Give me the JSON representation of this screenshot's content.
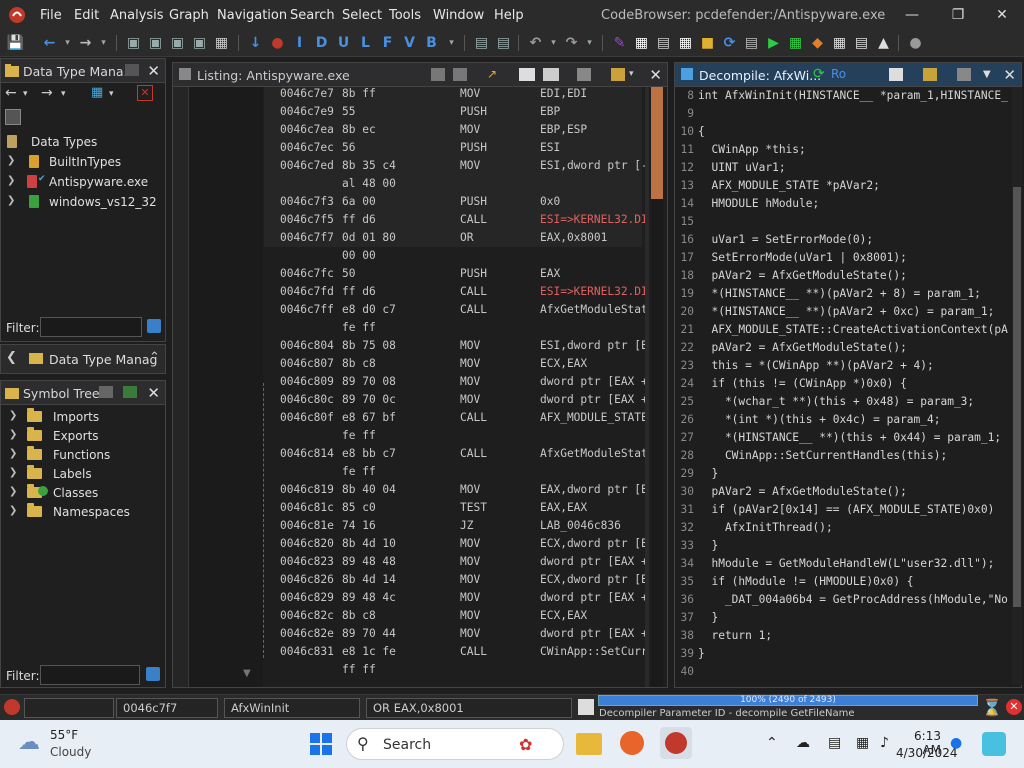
{
  "window": {
    "menu": [
      "File",
      "Edit",
      "Analysis",
      "Graph",
      "Navigation",
      "Search",
      "Select",
      "Tools",
      "Window",
      "Help"
    ],
    "title": "CodeBrowser: pcdefender:/Antispyware.exe"
  },
  "toolbar": {
    "letters": [
      "I",
      "D",
      "U",
      "L",
      "F",
      "V",
      "B"
    ]
  },
  "data_type_manager": {
    "title": "Data Type Mana...",
    "root": "Data Types",
    "items": [
      "BuiltInTypes",
      "Antispyware.exe",
      "windows_vs12_32"
    ],
    "filter_label": "Filter:",
    "collapsed_title": "Data Type Manag"
  },
  "symbol_tree": {
    "title": "Symbol Tree",
    "items": [
      "Imports",
      "Exports",
      "Functions",
      "Labels",
      "Classes",
      "Namespaces"
    ],
    "filter_label": "Filter:"
  },
  "listing": {
    "title": "Listing:  Antispyware.exe",
    "rows": [
      {
        "addr": "0046c7e7",
        "bytes": "8b ff",
        "mnem": "MOV",
        "ops": "EDI,EDI"
      },
      {
        "addr": "0046c7e9",
        "bytes": "55",
        "mnem": "PUSH",
        "ops": "EBP"
      },
      {
        "addr": "0046c7ea",
        "bytes": "8b ec",
        "mnem": "MOV",
        "ops": "EBP,ESP"
      },
      {
        "addr": "0046c7ec",
        "bytes": "56",
        "mnem": "PUSH",
        "ops": "ESI"
      },
      {
        "addr": "0046c7ed",
        "bytes": "8b 35 c4",
        "mnem": "MOV",
        "ops": "ESI,dword ptr [-"
      },
      {
        "addr": "",
        "bytes": "al 48 00",
        "mnem": "",
        "ops": ""
      },
      {
        "addr": "0046c7f3",
        "bytes": "6a 00",
        "mnem": "PUSH",
        "ops": "0x0"
      },
      {
        "addr": "0046c7f5",
        "bytes": "ff d6",
        "mnem": "CALL",
        "ops": "ESI=>KERNEL32.DI"
      },
      {
        "addr": "0046c7f7",
        "bytes": "0d 01 80",
        "mnem": "OR",
        "ops": "EAX,0x8001"
      },
      {
        "addr": "",
        "bytes": "00 00",
        "mnem": "",
        "ops": ""
      },
      {
        "addr": "0046c7fc",
        "bytes": "50",
        "mnem": "PUSH",
        "ops": "EAX"
      },
      {
        "addr": "0046c7fd",
        "bytes": "ff d6",
        "mnem": "CALL",
        "ops": "ESI=>KERNEL32.DI"
      },
      {
        "addr": "0046c7ff",
        "bytes": "e8 d0 c7",
        "mnem": "CALL",
        "ops": "AfxGetModuleStat"
      },
      {
        "addr": "",
        "bytes": "fe ff",
        "mnem": "",
        "ops": ""
      },
      {
        "addr": "0046c804",
        "bytes": "8b 75 08",
        "mnem": "MOV",
        "ops": "ESI,dword ptr [E"
      },
      {
        "addr": "0046c807",
        "bytes": "8b c8",
        "mnem": "MOV",
        "ops": "ECX,EAX"
      },
      {
        "addr": "0046c809",
        "bytes": "89 70 08",
        "mnem": "MOV",
        "ops": "dword ptr [EAX +"
      },
      {
        "addr": "0046c80c",
        "bytes": "89 70 0c",
        "mnem": "MOV",
        "ops": "dword ptr [EAX +"
      },
      {
        "addr": "0046c80f",
        "bytes": "e8 67 bf",
        "mnem": "CALL",
        "ops": "AFX_MODULE_STATE"
      },
      {
        "addr": "",
        "bytes": "fe ff",
        "mnem": "",
        "ops": ""
      },
      {
        "addr": "0046c814",
        "bytes": "e8 bb c7",
        "mnem": "CALL",
        "ops": "AfxGetModuleStat"
      },
      {
        "addr": "",
        "bytes": "fe ff",
        "mnem": "",
        "ops": ""
      },
      {
        "addr": "0046c819",
        "bytes": "8b 40 04",
        "mnem": "MOV",
        "ops": "EAX,dword ptr [E"
      },
      {
        "addr": "0046c81c",
        "bytes": "85 c0",
        "mnem": "TEST",
        "ops": "EAX,EAX"
      },
      {
        "addr": "0046c81e",
        "bytes": "74 16",
        "mnem": "JZ",
        "ops": "LAB_0046c836"
      },
      {
        "addr": "0046c820",
        "bytes": "8b 4d 10",
        "mnem": "MOV",
        "ops": "ECX,dword ptr [E"
      },
      {
        "addr": "0046c823",
        "bytes": "89 48 48",
        "mnem": "MOV",
        "ops": "dword ptr [EAX +"
      },
      {
        "addr": "0046c826",
        "bytes": "8b 4d 14",
        "mnem": "MOV",
        "ops": "ECX,dword ptr [E"
      },
      {
        "addr": "0046c829",
        "bytes": "89 48 4c",
        "mnem": "MOV",
        "ops": "dword ptr [EAX +"
      },
      {
        "addr": "0046c82c",
        "bytes": "8b c8",
        "mnem": "MOV",
        "ops": "ECX,EAX"
      },
      {
        "addr": "0046c82e",
        "bytes": "89 70 44",
        "mnem": "MOV",
        "ops": "dword ptr [EAX +"
      },
      {
        "addr": "0046c831",
        "bytes": "e8 1c fe",
        "mnem": "CALL",
        "ops": "CWinApp::SetCurr"
      },
      {
        "addr": "",
        "bytes": "ff ff",
        "mnem": "",
        "ops": ""
      }
    ]
  },
  "decompile": {
    "title": "Decompile: AfxWi...",
    "lines": [
      {
        "n": "8",
        "code": "int AfxWinInit(HINSTANCE__ *param_1,HINSTANCE_"
      },
      {
        "n": "9",
        "code": ""
      },
      {
        "n": "10",
        "code": "{"
      },
      {
        "n": "11",
        "code": "  CWinApp *this;"
      },
      {
        "n": "12",
        "code": "  UINT uVar1;"
      },
      {
        "n": "13",
        "code": "  AFX_MODULE_STATE *pAVar2;"
      },
      {
        "n": "14",
        "code": "  HMODULE hModule;"
      },
      {
        "n": "15",
        "code": ""
      },
      {
        "n": "16",
        "code": "  uVar1 = SetErrorMode(0);"
      },
      {
        "n": "17",
        "code": "  SetErrorMode(uVar1 | 0x8001);"
      },
      {
        "n": "18",
        "code": "  pAVar2 = AfxGetModuleState();"
      },
      {
        "n": "19",
        "code": "  *(HINSTANCE__ **)(pAVar2 + 8) = param_1;"
      },
      {
        "n": "20",
        "code": "  *(HINSTANCE__ **)(pAVar2 + 0xc) = param_1;"
      },
      {
        "n": "21",
        "code": "  AFX_MODULE_STATE::CreateActivationContext(pA"
      },
      {
        "n": "22",
        "code": "  pAVar2 = AfxGetModuleState();"
      },
      {
        "n": "23",
        "code": "  this = *(CWinApp **)(pAVar2 + 4);"
      },
      {
        "n": "24",
        "code": "  if (this != (CWinApp *)0x0) {"
      },
      {
        "n": "25",
        "code": "    *(wchar_t **)(this + 0x48) = param_3;"
      },
      {
        "n": "26",
        "code": "    *(int *)(this + 0x4c) = param_4;"
      },
      {
        "n": "27",
        "code": "    *(HINSTANCE__ **)(this + 0x44) = param_1;"
      },
      {
        "n": "28",
        "code": "    CWinApp::SetCurrentHandles(this);"
      },
      {
        "n": "29",
        "code": "  }"
      },
      {
        "n": "30",
        "code": "  pAVar2 = AfxGetModuleState();"
      },
      {
        "n": "31",
        "code": "  if (pAVar2[0x14] == (AFX_MODULE_STATE)0x0) "
      },
      {
        "n": "32",
        "code": "    AfxInitThread();"
      },
      {
        "n": "33",
        "code": "  }"
      },
      {
        "n": "34",
        "code": "  hModule = GetModuleHandleW(L\"user32.dll\");"
      },
      {
        "n": "35",
        "code": "  if (hModule != (HMODULE)0x0) {"
      },
      {
        "n": "36",
        "code": "    _DAT_004a06b4 = GetProcAddress(hModule,\"No"
      },
      {
        "n": "37",
        "code": "  }"
      },
      {
        "n": "38",
        "code": "  return 1;"
      },
      {
        "n": "39",
        "code": "}"
      },
      {
        "n": "40",
        "code": ""
      }
    ]
  },
  "status": {
    "address": "0046c7f7",
    "function": "AfxWinInit",
    "instruction": "OR EAX,0x8001",
    "progress_label": "100% (2490 of 2493)",
    "progress_value": 0.9988,
    "task": "Decompiler Parameter ID - decompile GetFileName"
  },
  "taskbar": {
    "temp": "55°F",
    "weather": "Cloudy",
    "search": "Search",
    "time": "6:13 AM",
    "date": "4/30/2024"
  }
}
